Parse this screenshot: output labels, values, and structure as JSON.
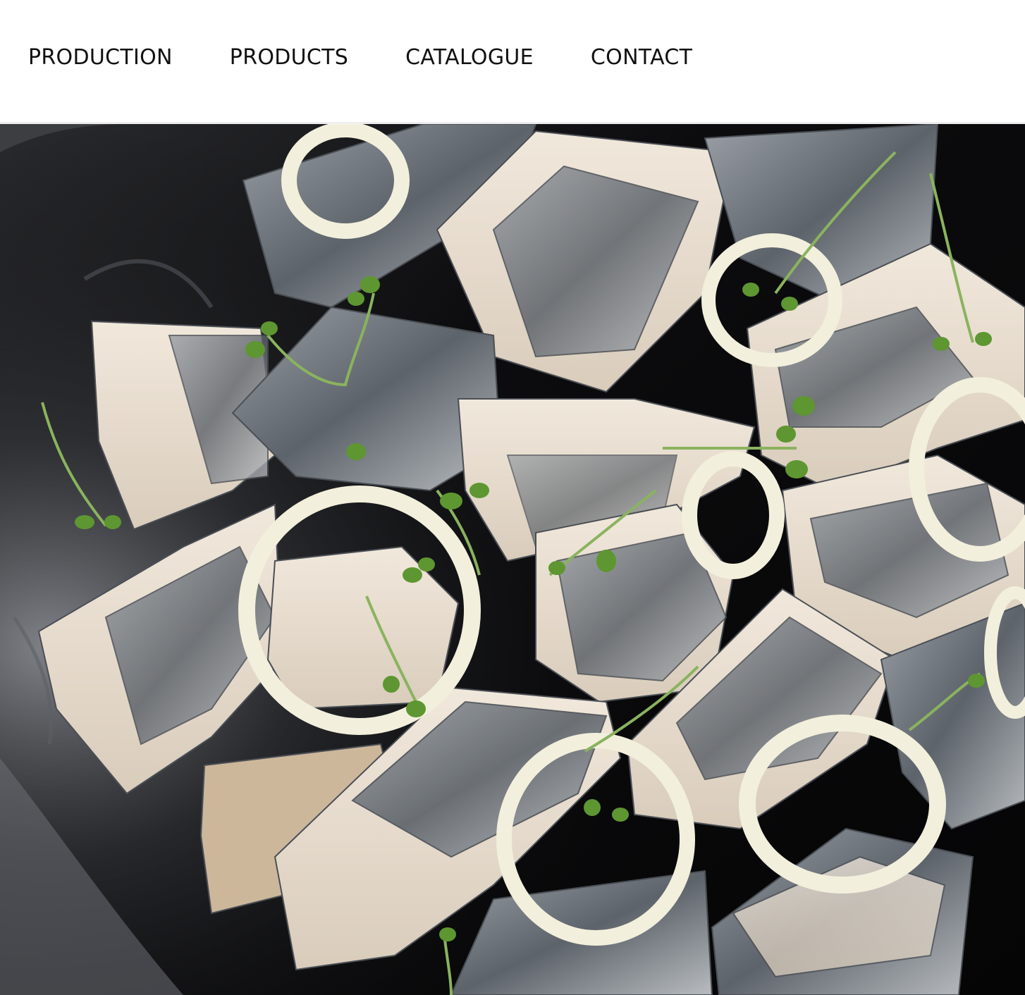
{
  "nav": {
    "items": [
      {
        "label": "PRODUCTION"
      },
      {
        "label": "PRODUCTS"
      },
      {
        "label": "CATALOGUE"
      },
      {
        "label": "CONTACT"
      }
    ]
  },
  "hero": {
    "image_icon": "herring-fillets-with-onion-rings-photo"
  },
  "colors": {
    "background": "#ffffff",
    "nav_text": "#111111",
    "divider": "#d6d6d6",
    "bowl": "#0b0b0c",
    "fish_flesh": "#e7ddd0",
    "fish_skin": "#6f7479",
    "onion": "#f2efdc",
    "microgreen": "#6a9a3a"
  }
}
